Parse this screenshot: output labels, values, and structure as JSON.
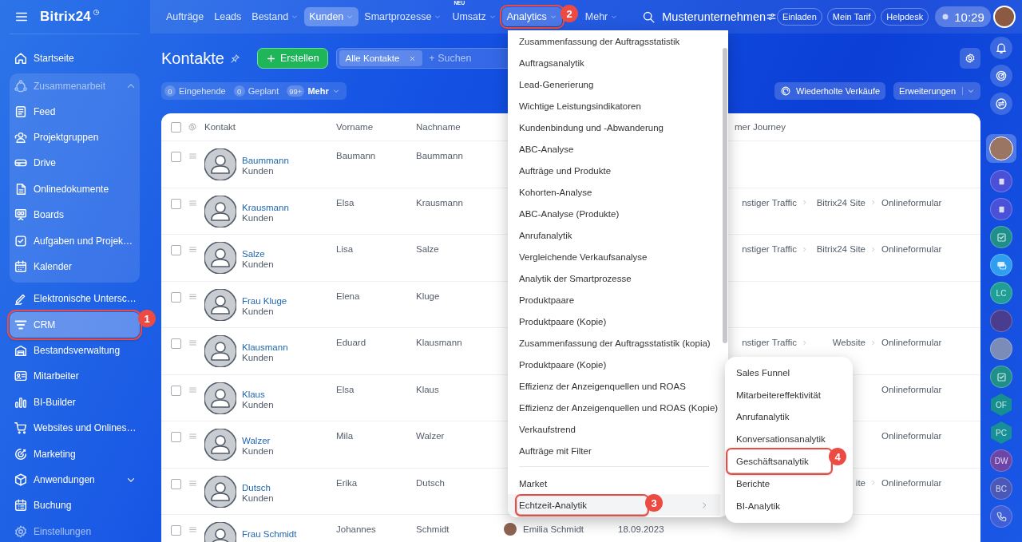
{
  "sidebar": {
    "logo": "Bitrix24",
    "items": [
      {
        "label": "Startseite",
        "kind": "link",
        "selected": false,
        "disabled": false
      },
      {
        "label": "Zusammenarbeit",
        "kind": "group",
        "expanded": true,
        "selected": false,
        "disabled": false,
        "children": [
          {
            "label": "Feed",
            "selected": false
          },
          {
            "label": "Projektgruppen",
            "selected": false
          },
          {
            "label": "Drive",
            "selected": false
          },
          {
            "label": "Onlinedokumente",
            "selected": false
          },
          {
            "label": "Boards",
            "selected": false
          },
          {
            "label": "Aufgaben und Projek…",
            "selected": false
          },
          {
            "label": "Kalender",
            "selected": false
          }
        ]
      },
      {
        "label": "Elektronische Untersc…",
        "kind": "link",
        "selected": false,
        "disabled": false
      },
      {
        "label": "CRM",
        "kind": "link",
        "selected": true,
        "disabled": false,
        "annotation": "1"
      },
      {
        "label": "Bestandsverwaltung",
        "kind": "link",
        "selected": false,
        "disabled": false
      },
      {
        "label": "Mitarbeiter",
        "kind": "link",
        "selected": false,
        "disabled": false
      },
      {
        "label": "BI-Builder",
        "kind": "link",
        "selected": false,
        "disabled": false
      },
      {
        "label": "Websites und Onlines…",
        "kind": "link",
        "selected": false,
        "disabled": false
      },
      {
        "label": "Marketing",
        "kind": "link",
        "selected": false,
        "disabled": false
      },
      {
        "label": "Anwendungen",
        "kind": "group",
        "expanded": false,
        "selected": false,
        "disabled": false
      },
      {
        "label": "Buchung",
        "kind": "link",
        "selected": false,
        "disabled": false
      },
      {
        "label": "Einstellungen",
        "kind": "link",
        "selected": false,
        "disabled": true
      }
    ]
  },
  "topbar": {
    "nav": [
      {
        "label": "Aufträge",
        "dropdown": false,
        "selected": false,
        "open": false
      },
      {
        "label": "Leads",
        "dropdown": false,
        "selected": false,
        "open": false
      },
      {
        "label": "Bestand",
        "dropdown": true,
        "selected": false,
        "open": false
      },
      {
        "label": "Kunden",
        "dropdown": true,
        "selected": true,
        "open": false
      },
      {
        "label": "Smartprozesse",
        "dropdown": true,
        "selected": false,
        "open": false
      },
      {
        "label": "Umsatz",
        "dropdown": true,
        "selected": false,
        "open": false,
        "badge": "NEU"
      },
      {
        "label": "Analytics",
        "dropdown": true,
        "selected": false,
        "open": true,
        "annotation": "2"
      },
      {
        "label": "Mehr",
        "dropdown": true,
        "selected": false,
        "open": false
      }
    ],
    "company": "Musterunternehmen",
    "buttons": [
      "Einladen",
      "Mein Tarif",
      "Helpdesk"
    ],
    "time": "10:29"
  },
  "page": {
    "title": "Kontakte",
    "create_button": "Erstellen",
    "filter": {
      "chip": "Alle Kontakte",
      "placeholder": "+ Suchen"
    },
    "counters": [
      {
        "count": "0",
        "label": "Eingehende",
        "dropdown": false
      },
      {
        "count": "0",
        "label": "Geplant",
        "dropdown": false
      },
      {
        "count": "99+",
        "label": "Mehr",
        "dropdown": true
      }
    ],
    "repeat_sales_button": "Wiederholte Verkäufe",
    "extensions_button": "Erweiterungen"
  },
  "table": {
    "select_all_checked": false,
    "columns": [
      "Kontakt",
      "Vorname",
      "Nachname",
      "mer Journey"
    ],
    "rows": [
      {
        "checked": false,
        "name": "Baummann",
        "type": "Kunden",
        "first_name": "Baumann",
        "last_name": "Baummann"
      },
      {
        "checked": false,
        "name": "Krausmann",
        "type": "Kunden",
        "first_name": "Elsa",
        "last_name": "Krausmann",
        "journey": [
          "nstiger Traffic",
          "Bitrix24 Site",
          "Onlineformular"
        ]
      },
      {
        "checked": false,
        "name": "Salze",
        "type": "Kunden",
        "first_name": "Lisa",
        "last_name": "Salze",
        "journey": [
          "nstiger Traffic",
          "Bitrix24 Site",
          "Onlineformular"
        ]
      },
      {
        "checked": false,
        "name": "Frau Kluge",
        "type": "Kunden",
        "first_name": "Elena",
        "last_name": "Kluge"
      },
      {
        "checked": false,
        "name": "Klausmann",
        "type": "Kunden",
        "first_name": "Eduard",
        "last_name": "Klausmann",
        "journey": [
          "nstiger Traffic",
          "Website",
          "Onlineformular"
        ]
      },
      {
        "checked": false,
        "name": "Klaus",
        "type": "Kunden",
        "first_name": "Elsa",
        "last_name": "Klaus",
        "journey": [
          "Onlineformular"
        ]
      },
      {
        "checked": false,
        "name": "Walzer",
        "type": "Kunden",
        "first_name": "Mila",
        "last_name": "Walzer",
        "journey": [
          "Onlineformular"
        ]
      },
      {
        "checked": false,
        "name": "Dutsch",
        "type": "Kunden",
        "first_name": "Erika",
        "last_name": "Dutsch",
        "journey": [
          "ite",
          "Onlineformular"
        ]
      },
      {
        "checked": false,
        "name": "Frau Schmidt",
        "first_name": "Johannes",
        "last_name": "Schmidt",
        "responsible": "Emilia Schmidt",
        "date": "18.09.2023"
      }
    ]
  },
  "menu": {
    "items": [
      {
        "kind": "item",
        "label": "Zusammenfassung der Auftragsstatistik",
        "selected": false,
        "submenu": false
      },
      {
        "kind": "item",
        "label": "Auftragsanalytik",
        "selected": false,
        "submenu": false
      },
      {
        "kind": "item",
        "label": "Lead-Generierung",
        "selected": false,
        "submenu": false
      },
      {
        "kind": "item",
        "label": "Wichtige Leistungsindikatoren",
        "selected": false,
        "submenu": false
      },
      {
        "kind": "item",
        "label": "Kundenbindung und -Abwanderung",
        "selected": false,
        "submenu": false
      },
      {
        "kind": "item",
        "label": "ABC-Analyse",
        "selected": false,
        "submenu": false
      },
      {
        "kind": "item",
        "label": "Aufträge und Produkte",
        "selected": false,
        "submenu": false
      },
      {
        "kind": "item",
        "label": "Kohorten-Analyse",
        "selected": false,
        "submenu": false
      },
      {
        "kind": "item",
        "label": "ABC-Analyse (Produkte)",
        "selected": false,
        "submenu": false
      },
      {
        "kind": "item",
        "label": "Anrufanalytik",
        "selected": false,
        "submenu": false
      },
      {
        "kind": "item",
        "label": "Vergleichende Verkaufsanalyse",
        "selected": false,
        "submenu": false
      },
      {
        "kind": "item",
        "label": "Analytik der Smartprozesse",
        "selected": false,
        "submenu": false
      },
      {
        "kind": "item",
        "label": "Produktpaare",
        "selected": false,
        "submenu": false
      },
      {
        "kind": "item",
        "label": "Produktpaare (Kopie)",
        "selected": false,
        "submenu": false
      },
      {
        "kind": "item",
        "label": "Zusammenfassung der Auftragsstatistik (kopia)",
        "selected": false,
        "submenu": false
      },
      {
        "kind": "item",
        "label": "Produktpaare (Kopie)",
        "selected": false,
        "submenu": false
      },
      {
        "kind": "item",
        "label": "Effizienz der Anzeigenquellen und ROAS",
        "selected": false,
        "submenu": false
      },
      {
        "kind": "item",
        "label": "Effizienz der Anzeigenquellen und ROAS (Kopie)",
        "selected": false,
        "submenu": false
      },
      {
        "kind": "item",
        "label": "Verkaufstrend",
        "selected": false,
        "submenu": false
      },
      {
        "kind": "item",
        "label": "Aufträge mit Filter",
        "selected": false,
        "submenu": false
      },
      {
        "kind": "separator"
      },
      {
        "kind": "item",
        "label": "Market",
        "selected": false,
        "submenu": false
      },
      {
        "kind": "item",
        "label": "Echtzeit-Analytik",
        "selected": true,
        "submenu": true,
        "annotation": "3"
      }
    ]
  },
  "submenu": {
    "items": [
      {
        "label": "Sales Funnel",
        "selected": false
      },
      {
        "label": "Mitarbeitereffektivität",
        "selected": false
      },
      {
        "label": "Anrufanalytik",
        "selected": false
      },
      {
        "label": "Konversationsanalytik",
        "selected": false
      },
      {
        "label": "Geschäftsanalytik",
        "selected": false,
        "annotation": "4"
      },
      {
        "label": "Berichte",
        "selected": false
      },
      {
        "label": "BI-Analytik",
        "selected": false
      }
    ]
  },
  "rail": [
    {
      "kind": "button",
      "selected": false
    },
    {
      "kind": "button",
      "selected": false
    },
    {
      "kind": "button",
      "selected": false
    },
    {
      "kind": "avatar",
      "selected": true
    },
    {
      "kind": "app",
      "selected": false,
      "color": "#4a50d8"
    },
    {
      "kind": "app",
      "selected": false,
      "color": "#4a50d8"
    },
    {
      "kind": "app",
      "selected": false,
      "color": "#1f8f8a"
    },
    {
      "kind": "app",
      "selected": false,
      "color": "#2f9df0"
    },
    {
      "kind": "initials",
      "text": "LC",
      "selected": false,
      "color": "#1f9e96"
    },
    {
      "kind": "photo",
      "selected": false
    },
    {
      "kind": "group-photo",
      "selected": false
    },
    {
      "kind": "app",
      "selected": false,
      "color": "#1f8f8a"
    },
    {
      "kind": "hexagon",
      "text": "OF",
      "selected": false,
      "color": "#168f91"
    },
    {
      "kind": "hexagon",
      "text": "PC",
      "selected": false,
      "color": "#178f96"
    },
    {
      "kind": "initials",
      "text": "DW",
      "selected": false,
      "color": "#6b46a8"
    },
    {
      "kind": "initials",
      "text": "BC",
      "selected": false,
      "color": "#4a59b8"
    },
    {
      "kind": "app",
      "selected": false,
      "color": "#3f5fd8"
    }
  ]
}
